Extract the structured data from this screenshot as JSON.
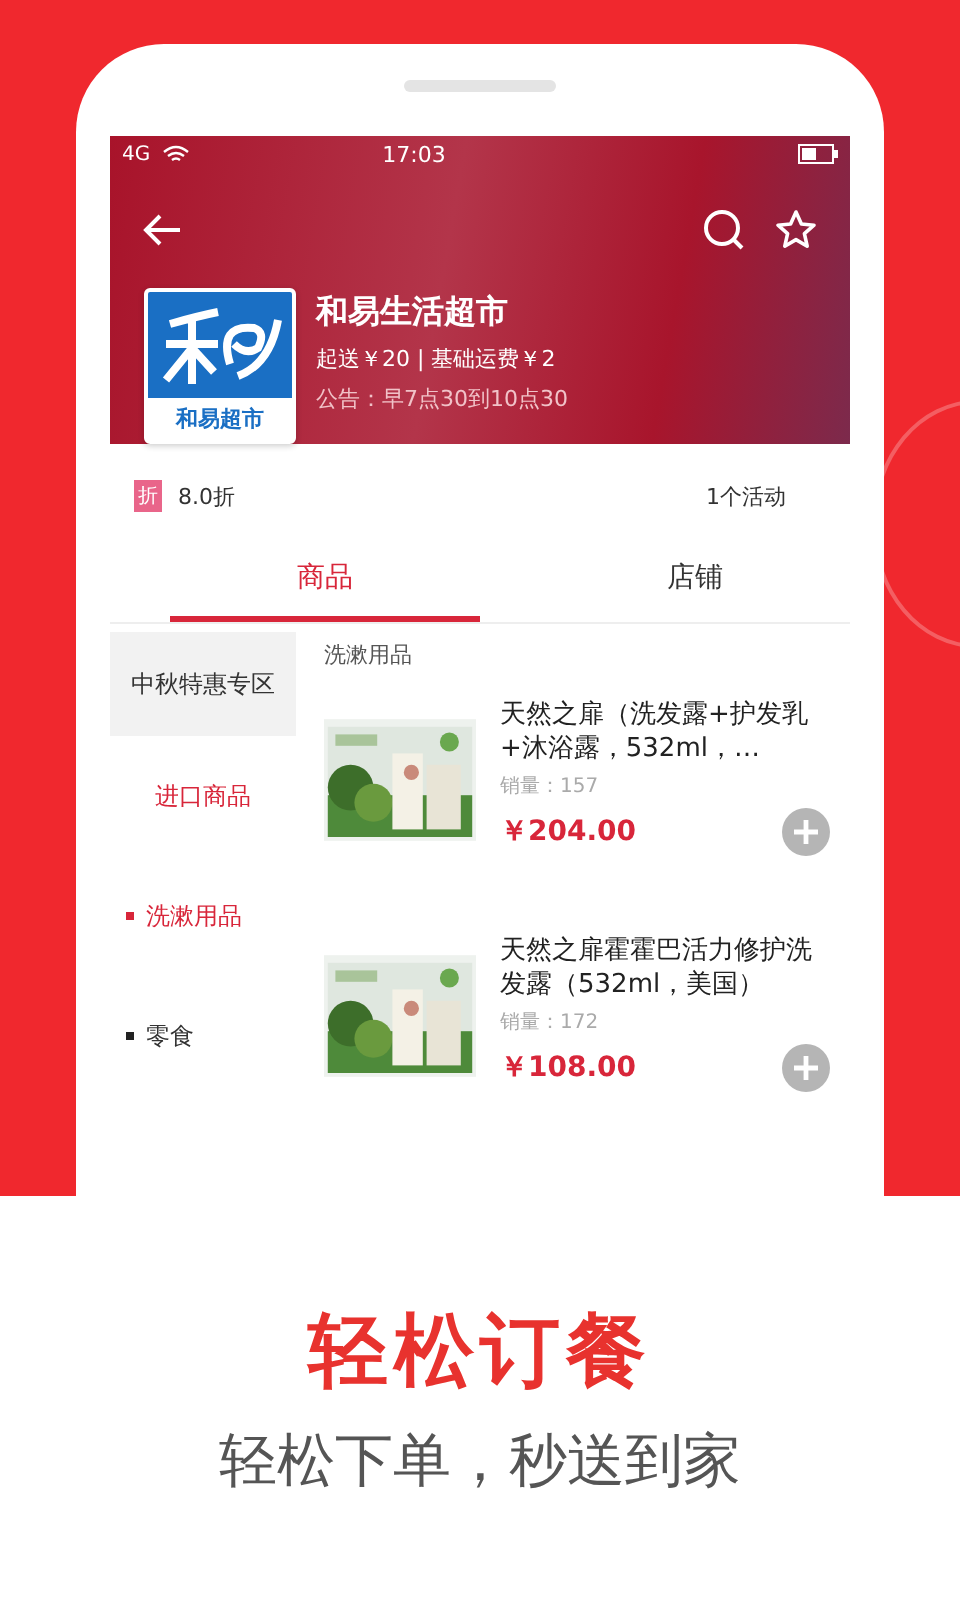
{
  "status_bar": {
    "signal": "4G",
    "time": "17:03"
  },
  "store": {
    "name": "和易生活超市",
    "logo_title": "和易超市",
    "delivery": "起送￥20 | 基础运费￥2",
    "notice": "公告：早7点30到10点30"
  },
  "promo": {
    "badge": "折",
    "discount": "8.0折",
    "activities": "1个活动"
  },
  "tabs": [
    {
      "label": "商品",
      "selected": true
    },
    {
      "label": "店铺",
      "selected": false
    }
  ],
  "sidebar": {
    "items": [
      {
        "label": "中秋特惠专区",
        "shaded": true,
        "highlighted": false,
        "bullet": false
      },
      {
        "label": "进口商品",
        "shaded": false,
        "highlighted": true,
        "bullet": false
      },
      {
        "label": "洗漱用品",
        "shaded": false,
        "highlighted": true,
        "bullet": true
      },
      {
        "label": "零食",
        "shaded": false,
        "highlighted": false,
        "bullet": true
      }
    ]
  },
  "section_title": "洗漱用品",
  "products": [
    {
      "name": "天然之扉（洗发露+护发乳+沐浴露，532ml，…",
      "sales": "销量：157",
      "price": "￥204.00"
    },
    {
      "name": "天然之扉霍霍巴活力修护洗发露（532ml，美国）",
      "sales": "销量：172",
      "price": "￥108.00"
    }
  ],
  "headline": "轻松订餐",
  "subline": "轻松下单，秒送到家"
}
